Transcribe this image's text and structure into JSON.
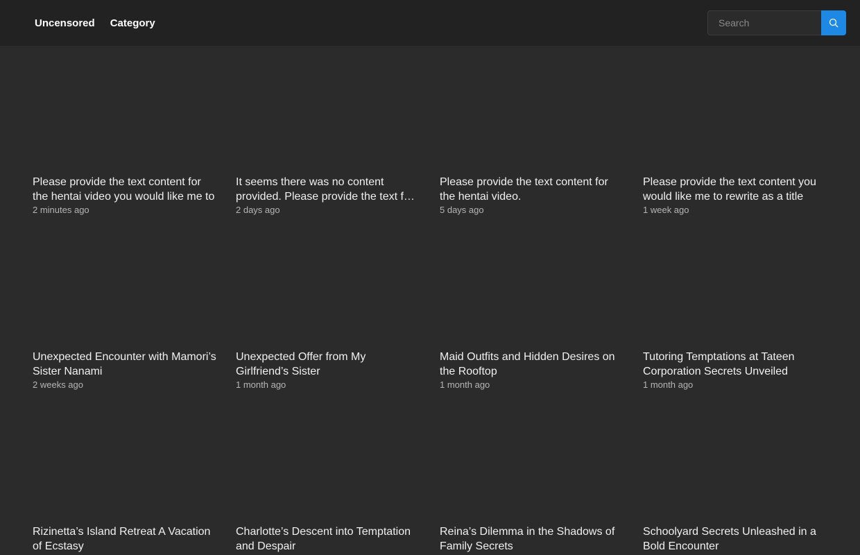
{
  "nav": {
    "items": [
      "Uncensored",
      "Category"
    ]
  },
  "search": {
    "placeholder": "Search"
  },
  "videos": [
    {
      "title": "Please provide the text content for the hentai video you would like me to",
      "time": "2 minutes ago"
    },
    {
      "title": "It seems there was no content provided. Please provide the text f…",
      "time": "2 days ago"
    },
    {
      "title": "Please provide the text content for the hentai video.",
      "time": "5 days ago"
    },
    {
      "title": "Please provide the text content you would like me to rewrite as a title",
      "time": "1 week ago"
    },
    {
      "title": "Unexpected Encounter with Mamori’s Sister Nanami",
      "time": "2 weeks ago"
    },
    {
      "title": "Unexpected Offer from My Girlfriend’s Sister",
      "time": "1 month ago"
    },
    {
      "title": "Maid Outfits and Hidden Desires on the Rooftop",
      "time": "1 month ago"
    },
    {
      "title": "Tutoring Temptations at Tateen Corporation Secrets Unveiled",
      "time": "1 month ago"
    },
    {
      "title": "Rizinetta’s Island Retreat A Vacation of Ecstasy",
      "time": ""
    },
    {
      "title": "Charlotte’s Descent into Temptation and Despair",
      "time": ""
    },
    {
      "title": "Reina’s Dilemma in the Shadows of Family Secrets",
      "time": ""
    },
    {
      "title": "Schoolyard Secrets Unleashed in a Bold Encounter",
      "time": ""
    }
  ],
  "colors": {
    "accent": "#1e88e5",
    "background": "#2b2b2b",
    "topbar": "#222222"
  }
}
